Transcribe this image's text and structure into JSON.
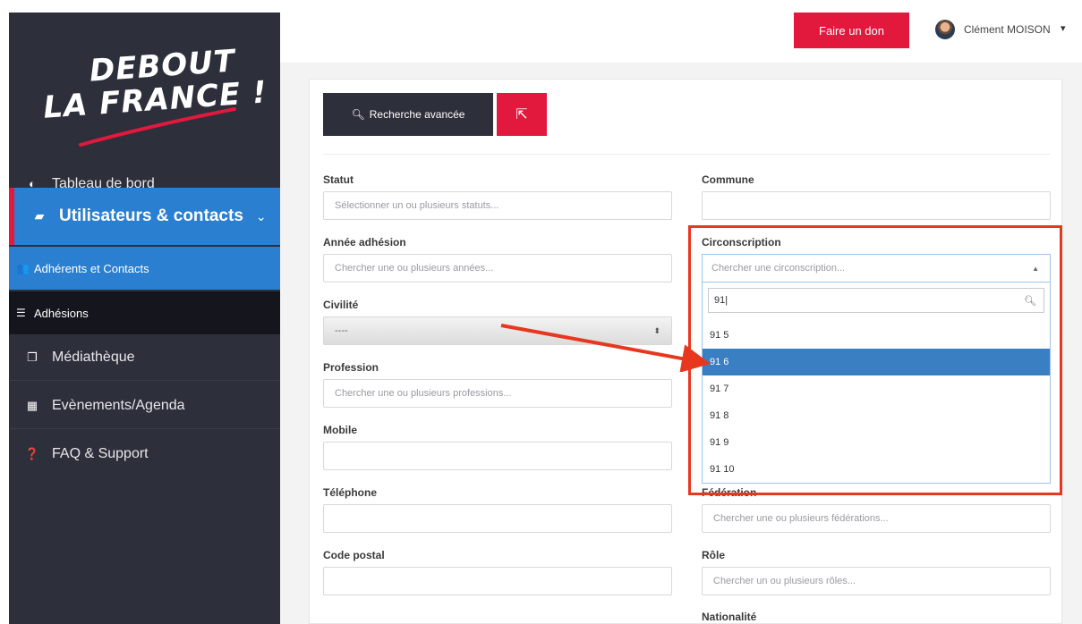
{
  "brand": {
    "logo_line1": "DEBOUT",
    "logo_line2": "LA FRANCE !"
  },
  "sidebar": {
    "items": [
      {
        "label": "Tableau de bord",
        "icon": "dashboard-icon"
      },
      {
        "label": "Utilisateurs & contacts",
        "icon": "briefcase-icon"
      },
      {
        "label": "Médiathèque",
        "icon": "images-icon"
      },
      {
        "label": "Evènements/Agenda",
        "icon": "calendar-icon"
      },
      {
        "label": "FAQ & Support",
        "icon": "question-icon"
      }
    ],
    "subitems": [
      {
        "label": "Adhérents et Contacts",
        "icon": "users-icon"
      },
      {
        "label": "Adhésions",
        "icon": "list-icon"
      }
    ]
  },
  "topbar": {
    "donate_label": "Faire un don",
    "user_name": "Clément MOISON"
  },
  "toolbar": {
    "search_label": "Recherche avancée"
  },
  "form": {
    "statut": {
      "label": "Statut",
      "placeholder": "Sélectionner un ou plusieurs statuts..."
    },
    "annee": {
      "label": "Année adhésion",
      "placeholder": "Chercher une ou plusieurs années..."
    },
    "civilite": {
      "label": "Civilité",
      "value": "----"
    },
    "profession": {
      "label": "Profession",
      "placeholder": "Chercher une ou plusieurs professions..."
    },
    "mobile": {
      "label": "Mobile",
      "value": ""
    },
    "telephone": {
      "label": "Téléphone",
      "value": ""
    },
    "code_postal": {
      "label": "Code postal",
      "value": ""
    },
    "commune": {
      "label": "Commune",
      "value": ""
    },
    "circonscription": {
      "label": "Circonscription",
      "placeholder": "Chercher une circonscription...",
      "search_value": "91",
      "options": [
        "91 5",
        "91 6",
        "91 7",
        "91 8",
        "91 9",
        "91 10"
      ],
      "active_index": 1
    },
    "federation": {
      "label": "Fédération",
      "placeholder": "Chercher une ou plusieurs fédérations..."
    },
    "role": {
      "label": "Rôle",
      "placeholder": "Chercher un ou plusieurs rôles..."
    },
    "nationalite": {
      "label": "Nationalité"
    }
  },
  "colors": {
    "sidebar": "#2d2f3b",
    "accent_blue": "#2a7fd0",
    "brand_red": "#e2183c",
    "annotation_red": "#e8371f"
  }
}
